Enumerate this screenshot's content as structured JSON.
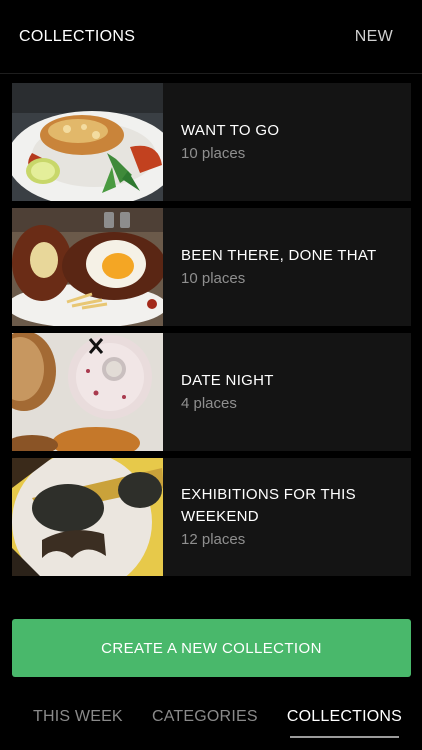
{
  "header": {
    "title": "COLLECTIONS",
    "new_label": "NEW"
  },
  "collections": [
    {
      "name": "WANT TO GO",
      "count": "10 places",
      "image": "lobster-plate"
    },
    {
      "name": "BEEN THERE, DONE THAT",
      "count": "10 places",
      "image": "scotch-egg-plate"
    },
    {
      "name": "DATE NIGHT",
      "count": "4 places",
      "image": "donuts"
    },
    {
      "name": "EXHIBITIONS FOR THIS WEEKEND",
      "count": "12 places",
      "image": "mannequin-sunglasses"
    }
  ],
  "create_button": {
    "label": "CREATE A NEW COLLECTION",
    "color": "#49b86b"
  },
  "tabs": [
    {
      "label": "THIS WEEK",
      "active": false
    },
    {
      "label": "CATEGORIES",
      "active": false
    },
    {
      "label": "COLLECTIONS",
      "active": true
    }
  ]
}
